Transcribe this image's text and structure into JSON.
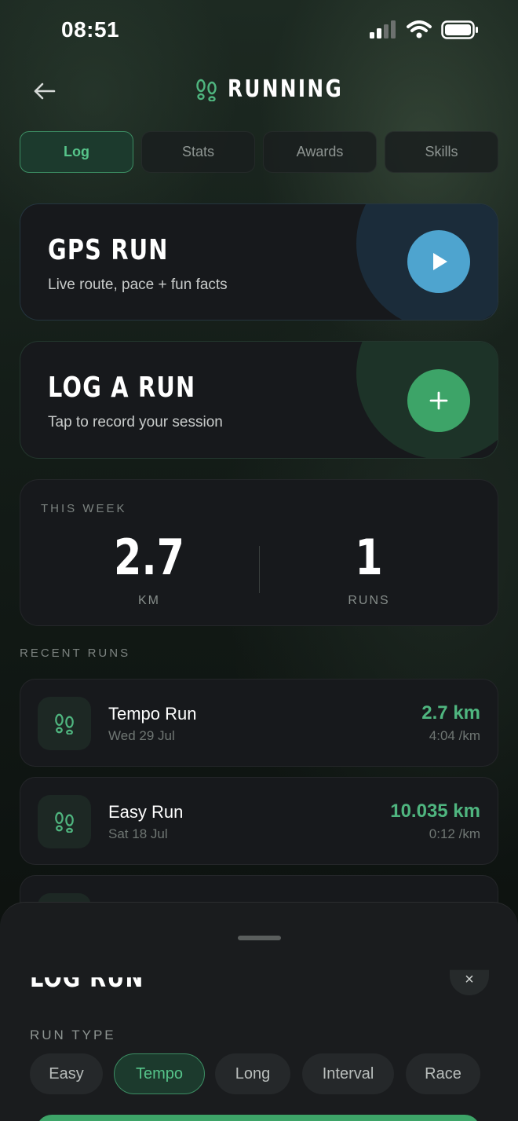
{
  "status": {
    "time": "08:51"
  },
  "header": {
    "title": "RUNNING"
  },
  "tabs": [
    {
      "label": "Log",
      "active": true
    },
    {
      "label": "Stats",
      "active": false
    },
    {
      "label": "Awards",
      "active": false
    },
    {
      "label": "Skills",
      "active": false
    }
  ],
  "gps_card": {
    "title": "GPS RUN",
    "subtitle": "Live route, pace + fun facts"
  },
  "log_card": {
    "title": "LOG A RUN",
    "subtitle": "Tap to record your session"
  },
  "this_week": {
    "label": "THIS WEEK",
    "distance_value": "2.7",
    "distance_unit": "KM",
    "runs_value": "1",
    "runs_unit": "RUNS"
  },
  "recent": {
    "label": "RECENT RUNS",
    "runs": [
      {
        "name": "Tempo Run",
        "date": "Wed 29 Jul",
        "distance": "2.7 km",
        "pace": "4:04 /km"
      },
      {
        "name": "Easy Run",
        "date": "Sat 18 Jul",
        "distance": "10.035 km",
        "pace": "0:12 /km"
      }
    ]
  },
  "sheet": {
    "title": "LOG RUN",
    "close_icon": "×",
    "run_type_label": "RUN TYPE",
    "run_types": [
      {
        "label": "Easy",
        "active": false
      },
      {
        "label": "Tempo",
        "active": true
      },
      {
        "label": "Long",
        "active": false
      },
      {
        "label": "Interval",
        "active": false
      },
      {
        "label": "Race",
        "active": false
      }
    ]
  },
  "colors": {
    "accent_green": "#4fb57f",
    "gps_blue": "#4ea4cf",
    "log_green": "#3da468"
  }
}
